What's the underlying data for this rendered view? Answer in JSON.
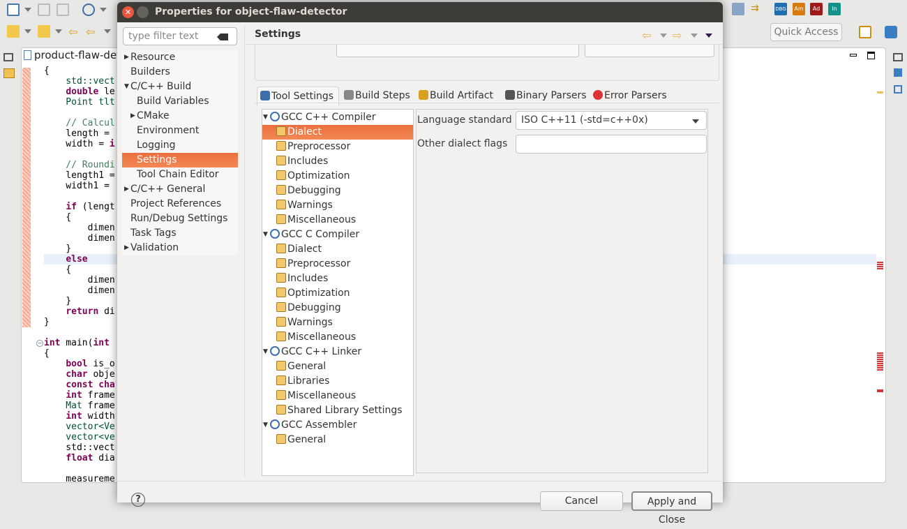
{
  "ide": {
    "quick_access": "Quick Access",
    "editor_tab": "product-flaw-det",
    "perspective_icons": [
      "DBG",
      "Am",
      "Ad",
      "In"
    ],
    "code_lines": [
      [
        [
          "{",
          ""
        ]
      ],
      [
        [
          "    std::vect",
          "t"
        ]
      ],
      [
        [
          "    ",
          ""
        ],
        [
          "double",
          "k"
        ],
        [
          " le",
          ""
        ]
      ],
      [
        [
          "    Point tlt",
          "t"
        ]
      ],
      [],
      [
        [
          "    // Calcul",
          "c"
        ]
      ],
      [
        [
          "    length = ",
          ""
        ]
      ],
      [
        [
          "    width = ",
          ""
        ],
        [
          "i",
          "k"
        ]
      ],
      [],
      [
        [
          "    // Roundi",
          "c"
        ]
      ],
      [
        [
          "    length1 =",
          ""
        ]
      ],
      [
        [
          "    width1 = ",
          ""
        ]
      ],
      [],
      [
        [
          "    ",
          ""
        ],
        [
          "if",
          "k"
        ],
        [
          " (lengt",
          ""
        ]
      ],
      [
        [
          "    {",
          ""
        ]
      ],
      [
        [
          "        dimen",
          ""
        ]
      ],
      [
        [
          "        dimen",
          ""
        ]
      ],
      [
        [
          "    }",
          ""
        ]
      ],
      [
        [
          "    ",
          ""
        ],
        [
          "else",
          "k"
        ]
      ],
      [
        [
          "    {",
          ""
        ]
      ],
      [
        [
          "        dimen",
          ""
        ]
      ],
      [
        [
          "        dimen",
          ""
        ]
      ],
      [
        [
          "    }",
          ""
        ]
      ],
      [
        [
          "    ",
          ""
        ],
        [
          "return",
          "k"
        ],
        [
          " di",
          ""
        ]
      ],
      [
        [
          "}",
          ""
        ]
      ],
      [],
      [
        [
          "int",
          "k"
        ],
        [
          " main(",
          ""
        ],
        [
          "int",
          "k"
        ],
        [
          " ",
          ""
        ]
      ],
      [
        [
          "{",
          ""
        ]
      ],
      [
        [
          "    ",
          ""
        ],
        [
          "bool",
          "k"
        ],
        [
          " is_o",
          ""
        ]
      ],
      [
        [
          "    ",
          ""
        ],
        [
          "char",
          "k"
        ],
        [
          " obje",
          ""
        ]
      ],
      [
        [
          "    ",
          ""
        ],
        [
          "const",
          "k"
        ],
        [
          " ",
          ""
        ],
        [
          "cha",
          "k"
        ]
      ],
      [
        [
          "    ",
          ""
        ],
        [
          "int",
          "k"
        ],
        [
          " frame",
          ""
        ]
      ],
      [
        [
          "    Mat",
          "t"
        ],
        [
          " frame",
          ""
        ]
      ],
      [
        [
          "    ",
          ""
        ],
        [
          "int",
          "k"
        ],
        [
          " width",
          ""
        ]
      ],
      [
        [
          "    vector<Ve",
          "t"
        ]
      ],
      [
        [
          "    vector<ve",
          "t"
        ]
      ],
      [
        [
          "    std::vect",
          ""
        ]
      ],
      [
        [
          "    ",
          ""
        ],
        [
          "float",
          "k"
        ],
        [
          " dia",
          ""
        ]
      ],
      [],
      [
        [
          "    measureme",
          ""
        ]
      ]
    ]
  },
  "dialog": {
    "title": "Properties for object-flaw-detector",
    "filter_placeholder": "type filter text",
    "page_title": "Settings",
    "nav_tree": [
      {
        "label": "Resource",
        "level": 0,
        "expander": "collapsed"
      },
      {
        "label": "Builders",
        "level": 0
      },
      {
        "label": "C/C++ Build",
        "level": 0,
        "expander": "expanded"
      },
      {
        "label": "Build Variables",
        "level": 1
      },
      {
        "label": "CMake",
        "level": 1,
        "expander": "collapsed"
      },
      {
        "label": "Environment",
        "level": 1
      },
      {
        "label": "Logging",
        "level": 1
      },
      {
        "label": "Settings",
        "level": 1,
        "selected": true
      },
      {
        "label": "Tool Chain Editor",
        "level": 1
      },
      {
        "label": "C/C++ General",
        "level": 0,
        "expander": "collapsed"
      },
      {
        "label": "Project References",
        "level": 0
      },
      {
        "label": "Run/Debug Settings",
        "level": 0
      },
      {
        "label": "Task Tags",
        "level": 0
      },
      {
        "label": "Validation",
        "level": 0,
        "expander": "collapsed"
      }
    ],
    "tabs": [
      {
        "label": "Tool Settings",
        "icon": "tool-settings-icon",
        "active": true
      },
      {
        "label": "Build Steps",
        "icon": "build-steps-icon"
      },
      {
        "label": "Build Artifact",
        "icon": "build-artifact-icon"
      },
      {
        "label": "Binary Parsers",
        "icon": "binary-parsers-icon"
      },
      {
        "label": "Error Parsers",
        "icon": "error-parsers-icon"
      }
    ],
    "tool_tree": [
      {
        "label": "GCC C++ Compiler",
        "level": 0
      },
      {
        "label": "Dialect",
        "level": 1,
        "selected": true
      },
      {
        "label": "Preprocessor",
        "level": 1
      },
      {
        "label": "Includes",
        "level": 1
      },
      {
        "label": "Optimization",
        "level": 1
      },
      {
        "label": "Debugging",
        "level": 1
      },
      {
        "label": "Warnings",
        "level": 1
      },
      {
        "label": "Miscellaneous",
        "level": 1
      },
      {
        "label": "GCC C Compiler",
        "level": 0
      },
      {
        "label": "Dialect",
        "level": 1
      },
      {
        "label": "Preprocessor",
        "level": 1
      },
      {
        "label": "Includes",
        "level": 1
      },
      {
        "label": "Optimization",
        "level": 1
      },
      {
        "label": "Debugging",
        "level": 1
      },
      {
        "label": "Warnings",
        "level": 1
      },
      {
        "label": "Miscellaneous",
        "level": 1
      },
      {
        "label": "GCC C++ Linker",
        "level": 0
      },
      {
        "label": "General",
        "level": 1
      },
      {
        "label": "Libraries",
        "level": 1
      },
      {
        "label": "Miscellaneous",
        "level": 1
      },
      {
        "label": "Shared Library Settings",
        "level": 1
      },
      {
        "label": "GCC Assembler",
        "level": 0
      },
      {
        "label": "General",
        "level": 1
      }
    ],
    "language_standard_label": "Language standard",
    "language_standard_value": "ISO C++11 (-std=c++0x)",
    "other_flags_label": "Other dialect flags",
    "other_flags_value": "",
    "cancel": "Cancel",
    "apply_close": "Apply and Close"
  },
  "colors": {
    "selection": "#f0774a",
    "titlebar": "#3c3b37",
    "keyword": "#7f0055"
  }
}
